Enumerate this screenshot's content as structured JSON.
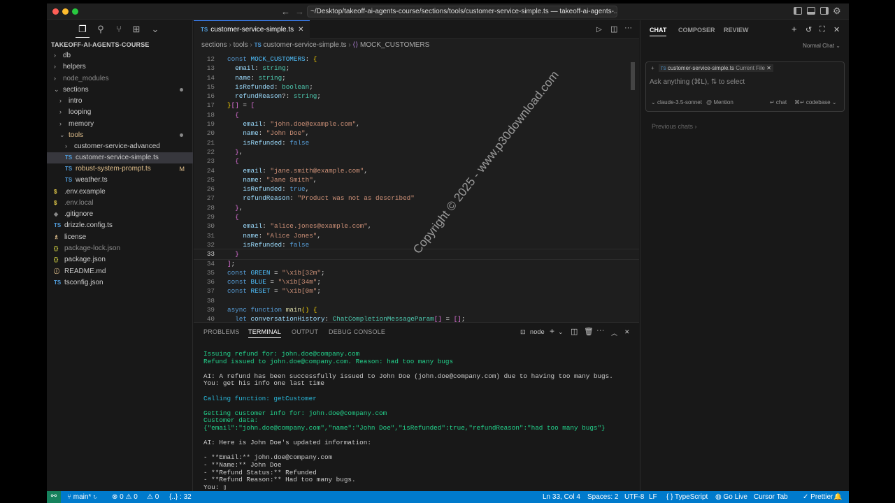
{
  "titlebar": {
    "path": "~/Desktop/takeoff-ai-agents-course/sections/tools/customer-service-simple.ts — takeoff-ai-agents-..."
  },
  "explorer": {
    "root": "TAKEOFF-AI-AGENTS-COURSE",
    "items": [
      {
        "label": "db",
        "chev": "›",
        "indent": 0,
        "color": "#ccc"
      },
      {
        "label": "helpers",
        "chev": "›",
        "indent": 0,
        "color": "#ccc"
      },
      {
        "label": "node_modules",
        "chev": "›",
        "indent": 0,
        "color": "#8b8b8b"
      },
      {
        "label": "sections",
        "chev": "⌄",
        "indent": 0,
        "color": "#ccc",
        "dot": true
      },
      {
        "label": "intro",
        "chev": "›",
        "indent": 1,
        "color": "#ccc"
      },
      {
        "label": "looping",
        "chev": "›",
        "indent": 1,
        "color": "#ccc"
      },
      {
        "label": "memory",
        "chev": "›",
        "indent": 1,
        "color": "#ccc"
      },
      {
        "label": "tools",
        "chev": "⌄",
        "indent": 1,
        "color": "#e2c08d",
        "dot": true
      },
      {
        "label": "customer-service-advanced",
        "chev": "›",
        "indent": 2,
        "color": "#ccc"
      },
      {
        "label": "customer-service-simple.ts",
        "icon": "TS",
        "indent": 2,
        "color": "#ccc",
        "selected": true
      },
      {
        "label": "robust-system-prompt.ts",
        "icon": "TS",
        "indent": 2,
        "color": "#e2c08d",
        "badge": "M"
      },
      {
        "label": "weather.ts",
        "icon": "TS",
        "indent": 2,
        "color": "#ccc"
      },
      {
        "label": ".env.example",
        "icon": "$",
        "indent": 0,
        "color": "#ccc"
      },
      {
        "label": ".env.local",
        "icon": "$",
        "indent": 0,
        "color": "#8b8b8b"
      },
      {
        "label": ".gitignore",
        "icon": "◆",
        "indent": 0,
        "color": "#ccc"
      },
      {
        "label": "drizzle.config.ts",
        "icon": "TS",
        "indent": 0,
        "color": "#ccc"
      },
      {
        "label": "license",
        "icon": "♗",
        "indent": 0,
        "color": "#ccc"
      },
      {
        "label": "package-lock.json",
        "icon": "{}",
        "indent": 0,
        "color": "#8b8b8b"
      },
      {
        "label": "package.json",
        "icon": "{}",
        "indent": 0,
        "color": "#ccc"
      },
      {
        "label": "README.md",
        "icon": "ⓘ",
        "indent": 0,
        "color": "#ccc"
      },
      {
        "label": "tsconfig.json",
        "icon": "TS",
        "indent": 0,
        "color": "#ccc"
      }
    ]
  },
  "editor": {
    "tab": "customer-service-simple.ts",
    "breadcrumb": [
      "sections",
      "tools",
      "customer-service-simple.ts",
      "MOCK_CUSTOMERS"
    ]
  },
  "code": [
    {
      "n": "12",
      "h": "<span class='k'>const</span> <span class='c'>MOCK_CUSTOMERS</span><span class='w'>: </span><span class='y'>{</span>"
    },
    {
      "n": "13",
      "h": "  <span class='p'>email</span><span class='w'>: </span><span class='t'>string</span><span class='w'>;</span>"
    },
    {
      "n": "14",
      "h": "  <span class='p'>name</span><span class='w'>: </span><span class='t'>string</span><span class='w'>;</span>"
    },
    {
      "n": "15",
      "h": "  <span class='p'>isRefunded</span><span class='w'>: </span><span class='t'>boolean</span><span class='w'>;</span>"
    },
    {
      "n": "16",
      "h": "  <span class='p'>refundReason</span><span class='w'>?: </span><span class='t'>string</span><span class='w'>;</span>"
    },
    {
      "n": "17",
      "h": "<span class='y'>}</span><span class='b'>[]</span><span class='w'> = </span><span class='b'>[</span>"
    },
    {
      "n": "18",
      "h": "  <span class='b'>{</span>"
    },
    {
      "n": "19",
      "h": "    <span class='p'>email</span><span class='w'>: </span><span class='s'>\"john.doe@example.com\"</span><span class='w'>,</span>"
    },
    {
      "n": "20",
      "h": "    <span class='p'>name</span><span class='w'>: </span><span class='s'>\"John Doe\"</span><span class='w'>,</span>"
    },
    {
      "n": "21",
      "h": "    <span class='p'>isRefunded</span><span class='w'>: </span><span class='k'>false</span>"
    },
    {
      "n": "22",
      "h": "  <span class='b'>}</span><span class='w'>,</span>"
    },
    {
      "n": "23",
      "h": "  <span class='b'>{</span>"
    },
    {
      "n": "24",
      "h": "    <span class='p'>email</span><span class='w'>: </span><span class='s'>\"jane.smith@example.com\"</span><span class='w'>,</span>"
    },
    {
      "n": "25",
      "h": "    <span class='p'>name</span><span class='w'>: </span><span class='s'>\"Jane Smith\"</span><span class='w'>,</span>"
    },
    {
      "n": "26",
      "h": "    <span class='p'>isRefunded</span><span class='w'>: </span><span class='k'>true</span><span class='w'>,</span>"
    },
    {
      "n": "27",
      "h": "    <span class='p'>refundReason</span><span class='w'>: </span><span class='s'>\"Product was not as described\"</span>"
    },
    {
      "n": "28",
      "h": "  <span class='b'>}</span><span class='w'>,</span>"
    },
    {
      "n": "29",
      "h": "  <span class='b'>{</span>"
    },
    {
      "n": "30",
      "h": "    <span class='p'>email</span><span class='w'>: </span><span class='s'>\"alice.jones@example.com\"</span><span class='w'>,</span>"
    },
    {
      "n": "31",
      "h": "    <span class='p'>name</span><span class='w'>: </span><span class='s'>\"Alice Jones\"</span><span class='w'>,</span>"
    },
    {
      "n": "32",
      "h": "    <span class='p'>isRefunded</span><span class='w'>: </span><span class='k'>false</span>"
    },
    {
      "n": "33",
      "h": "  <span class='b'>}</span>",
      "cur": true
    },
    {
      "n": "34",
      "h": "<span class='b'>]</span><span class='w'>;</span>"
    },
    {
      "n": "35",
      "h": "<span class='k'>const</span> <span class='c'>GREEN</span><span class='w'> = </span><span class='s'>\"\\x1b[32m\"</span><span class='w'>;</span>"
    },
    {
      "n": "36",
      "h": "<span class='k'>const</span> <span class='c'>BLUE</span><span class='w'> = </span><span class='s'>\"\\x1b[34m\"</span><span class='w'>;</span>"
    },
    {
      "n": "37",
      "h": "<span class='k'>const</span> <span class='c'>RESET</span><span class='w'> = </span><span class='s'>\"\\x1b[0m\"</span><span class='w'>;</span>"
    },
    {
      "n": "38",
      "h": ""
    },
    {
      "n": "39",
      "h": "<span class='k'>async</span> <span class='k'>function</span> <span class='f'>main</span><span class='y'>()</span> <span class='y'>{</span>"
    },
    {
      "n": "40",
      "h": "  <span class='k'>let</span> <span class='p'>conversationHistory</span><span class='w'>: </span><span class='t'>ChatCompletionMessageParam</span><span class='b'>[]</span><span class='w'> = </span><span class='b'>[]</span><span class='w'>;</span>"
    }
  ],
  "panel": {
    "tabs": [
      "PROBLEMS",
      "TERMINAL",
      "OUTPUT",
      "DEBUG CONSOLE"
    ],
    "shell": "node"
  },
  "terminal": [
    {
      "t": "Issuing refund for: john.doe@company.com",
      "c": "g"
    },
    {
      "t": "Refund issued to john.doe@company.com. Reason: had too many bugs",
      "c": "g"
    },
    {
      "t": "",
      "c": ""
    },
    {
      "t": "AI: A refund has been successfully issued to John Doe (john.doe@company.com) due to having too many bugs.",
      "c": ""
    },
    {
      "t": "You: get his info one last time",
      "c": ""
    },
    {
      "t": "",
      "c": ""
    },
    {
      "t": "Calling function: getCustomer",
      "c": "cy"
    },
    {
      "t": "",
      "c": ""
    },
    {
      "t": "Getting customer info for: john.doe@company.com",
      "c": "g"
    },
    {
      "t": "Customer data:",
      "c": "g"
    },
    {
      "t": "{\"email\":\"john.doe@company.com\",\"name\":\"John Doe\",\"isRefunded\":true,\"refundReason\":\"had too many bugs\"}",
      "c": "g"
    },
    {
      "t": "",
      "c": ""
    },
    {
      "t": "AI: Here is John Doe's updated information:",
      "c": ""
    },
    {
      "t": "",
      "c": ""
    },
    {
      "t": "- **Email:** john.doe@company.com",
      "c": ""
    },
    {
      "t": "- **Name:** John Doe",
      "c": ""
    },
    {
      "t": "- **Refund Status:** Refunded",
      "c": ""
    },
    {
      "t": "- **Refund Reason:** Had too many bugs.",
      "c": ""
    },
    {
      "t": "You: ▯",
      "c": ""
    }
  ],
  "chat": {
    "tabs": [
      "CHAT",
      "COMPOSER",
      "REVIEW"
    ],
    "mode": "Normal Chat ⌄",
    "file_chip": "customer-service-simple.ts",
    "file_tag": "Current File",
    "placeholder": "Ask anything (⌘L), ⇅ to select",
    "model": "claude-3.5-sonnet",
    "mention": "@ Mention",
    "chat_btn": "↵ chat",
    "codebase_btn": "⌘↵ codebase ⌄",
    "previous": "Previous chats ›"
  },
  "status": {
    "branch": "main*",
    "errors": "0",
    "warnings": "0",
    "ports": "0",
    "selection": "{..} : 32",
    "position": "Ln 33, Col 4",
    "spaces": "Spaces: 2",
    "encoding": "UTF-8",
    "eol": "LF",
    "language": "{ } TypeScript",
    "golive": "Go Live",
    "cursortab": "Cursor Tab",
    "prettier": "✓ Prettier"
  },
  "watermark": "Copyright © 2025 - www.p30download.com"
}
